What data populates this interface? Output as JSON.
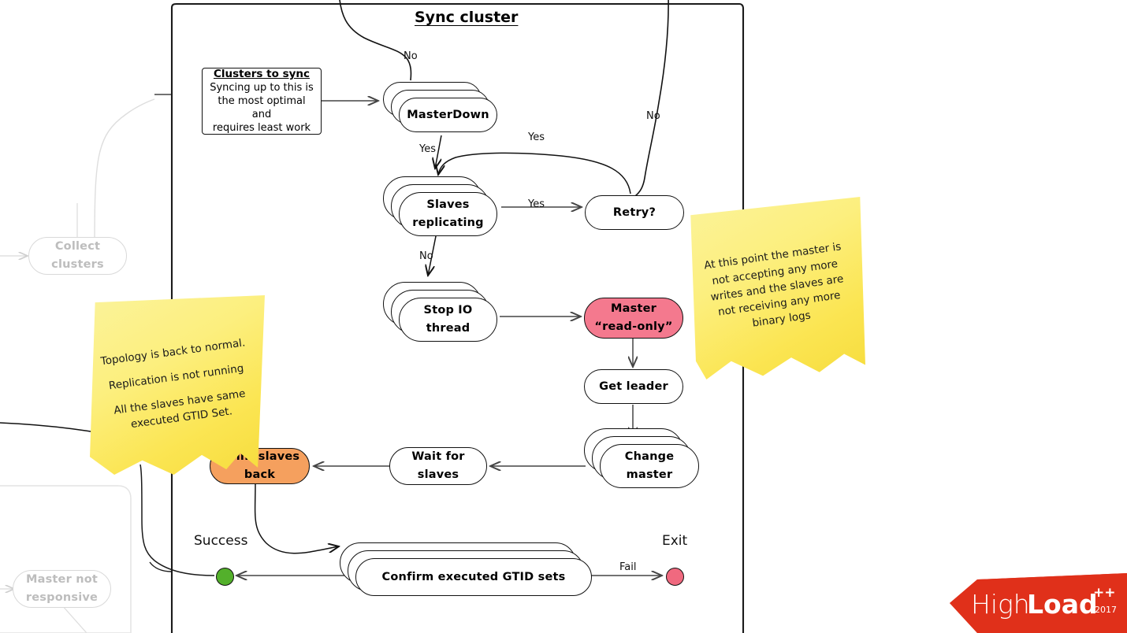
{
  "diagram": {
    "title": "Sync cluster",
    "nodes": {
      "clusters_to_sync": {
        "title": "Clusters to sync",
        "body_line1": "Syncing up to this is",
        "body_line2": "the most optimal and",
        "body_line3": "requires least work"
      },
      "master_down": {
        "label": "MasterDown"
      },
      "slaves_replicating": {
        "line1": "Slaves",
        "line2": "replicating"
      },
      "retry": {
        "label": "Retry?"
      },
      "stop_io_thread": {
        "line1": "Stop IO",
        "line2": "thread"
      },
      "master_read_only": {
        "line1": "Master",
        "line2": "“read-only”",
        "color": "#f4798e"
      },
      "get_leader": {
        "label": "Get leader"
      },
      "change_master": {
        "line1": "Change",
        "line2": "master"
      },
      "wait_for_slaves": {
        "line1": "Wait for",
        "line2": "slaves"
      },
      "point_slaves_back": {
        "line1": "Point slaves",
        "line2": "back",
        "color": "#f5a05e"
      },
      "confirm_gtid": {
        "label": "Confirm executed GTID sets"
      },
      "collect_clusters": {
        "line1": "Collect",
        "line2": "clusters",
        "color": "#bdbdbd"
      },
      "master_not_responsive": {
        "line1": "Master not",
        "line2": "responsive",
        "color": "#bdbdbd"
      }
    },
    "terminators": {
      "success_label": "Success",
      "success_color": "#53b02b",
      "exit_label": "Exit",
      "exit_color": "#f0697f"
    },
    "edge_labels": {
      "no_top": "No",
      "no_right": "No",
      "yes_masterdown": "Yes",
      "yes_retry_loop": "Yes",
      "yes_slaves": "Yes",
      "no_slaves": "No",
      "fail": "Fail"
    },
    "notes": {
      "left": {
        "line1": "Topology is back to normal.",
        "line2": "Replication is not running",
        "line3": "All the slaves have same",
        "line4": "executed GTID Set."
      },
      "right": {
        "line1": "At this point the master is",
        "line2": "not accepting any more",
        "line3": "writes and the slaves are",
        "line4": "not receiving any more",
        "line5": "binary logs"
      }
    }
  },
  "logo": {
    "part1": "High",
    "part2": "Load",
    "plusplus": "++",
    "year": "2017",
    "color": "#e0301a"
  }
}
